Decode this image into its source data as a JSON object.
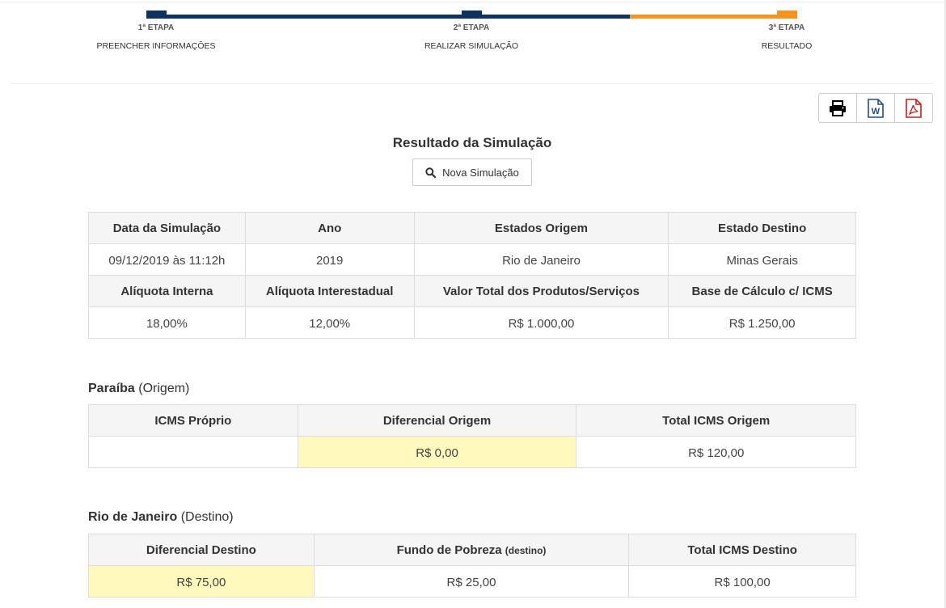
{
  "stepper": {
    "steps": [
      {
        "num": "1ª ETAPA",
        "name": "PREENCHER INFORMAÇÕES"
      },
      {
        "num": "2ª ETAPA",
        "name": "REALIZAR SIMULAÇÃO"
      },
      {
        "num": "3ª ETAPA",
        "name": "RESULTADO"
      }
    ],
    "colors": {
      "completed": "#0e3360",
      "current": "#f7941d"
    }
  },
  "toolbar": {
    "icons": [
      "print-icon",
      "word-icon",
      "pdf-icon"
    ],
    "word_letter": "W"
  },
  "page": {
    "title": "Resultado da Simulação",
    "new_sim_label": "Nova Simulação"
  },
  "info_table": {
    "headers1": [
      "Data da Simulação",
      "Ano",
      "Estados Origem",
      "Estado Destino"
    ],
    "row1": [
      "09/12/2019 às 11:12h",
      "2019",
      "Rio de Janeiro",
      "Minas Gerais"
    ],
    "headers2": [
      "Alíquota Interna",
      "Alíquota Interestadual",
      "Valor Total dos Produtos/Serviços",
      "Base de Cálculo c/ ICMS"
    ],
    "row2": [
      "18,00%",
      "12,00%",
      "R$ 1.000,00",
      "R$ 1.250,00"
    ]
  },
  "origem": {
    "state": "Paraíba",
    "suffix": "(Origem)",
    "headers": [
      "ICMS Próprio",
      "Diferencial Origem",
      "Total ICMS Origem"
    ],
    "values": [
      "",
      "R$ 0,00",
      "R$ 120,00"
    ]
  },
  "destino": {
    "state": "Rio de Janeiro",
    "suffix": "(Destino)",
    "headers": [
      "Diferencial Destino",
      "Fundo de Pobreza",
      "Total ICMS Destino"
    ],
    "header_small": "(destino)",
    "values": [
      "R$ 75,00",
      "R$ 25,00",
      "R$ 100,00"
    ]
  },
  "highlight_color": "#fff9be"
}
